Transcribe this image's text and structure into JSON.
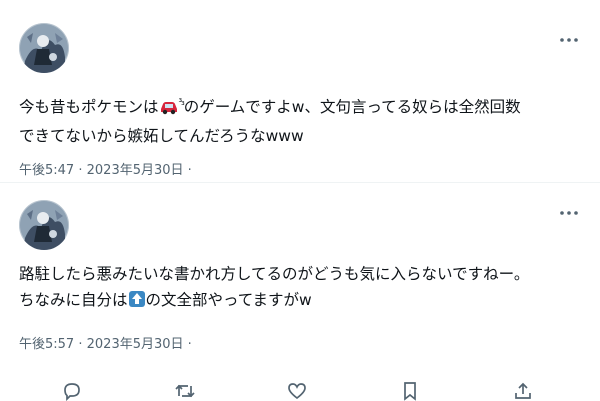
{
  "posts": [
    {
      "text_line1_pre": "今も昔もポケモンは",
      "car_emoji": "🚗",
      "superscript": "³₃",
      "text_line1_post": "のゲームですよw、文句言ってる奴らは全然回数",
      "text_line2": "できてないから嫉妬してんだろうなwww",
      "time": "午後5:47",
      "sep": "·",
      "date": "2023年5月30日",
      "trail": "·"
    },
    {
      "text_line1": "路駐したら悪みたいな書かれ方してるのがどうも気に入らないですねー。",
      "text_line2_pre": "ちなみに自分は",
      "up_emoji": "⬆️",
      "text_line2_post": "の文全部やってますがw",
      "time": "午後5:57",
      "sep": "·",
      "date": "2023年5月30日",
      "trail": "·"
    }
  ],
  "icons": {
    "more": "more-icon",
    "actions": [
      "reply-icon",
      "repost-icon",
      "like-icon",
      "bookmark-icon",
      "share-icon"
    ]
  },
  "colors": {
    "text": "#0f1419",
    "muted": "#536471",
    "divider": "#eff3f4",
    "car": "#d7263d",
    "up_button": "#3b88c3"
  }
}
